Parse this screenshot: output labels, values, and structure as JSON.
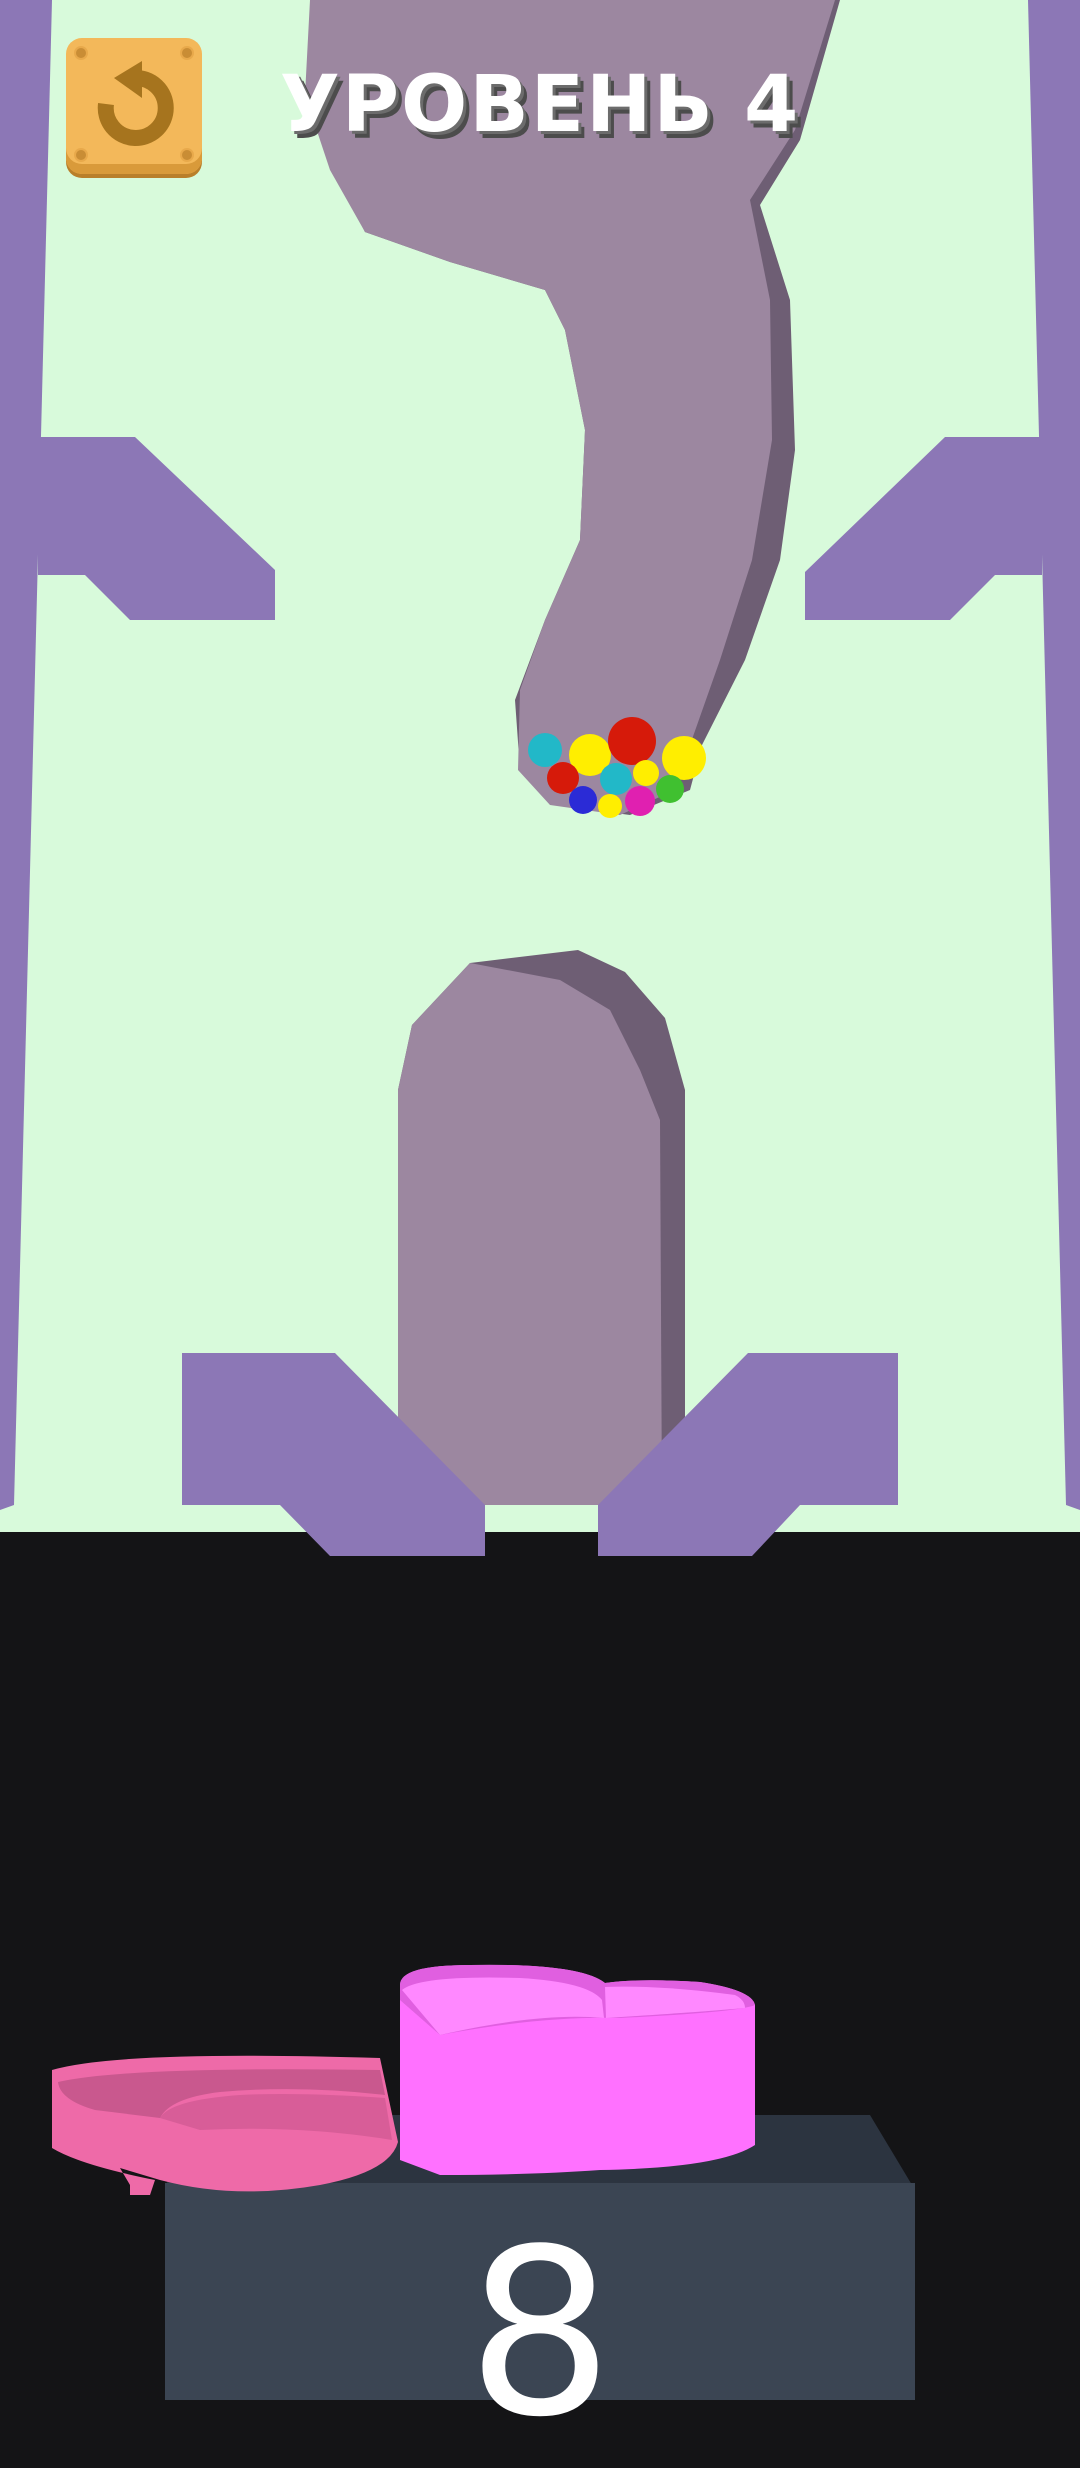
{
  "header": {
    "level_title": "УРОВЕНЬ 4",
    "restart_icon": "restart-arrow-icon"
  },
  "game": {
    "balls_in_dig": 11,
    "ball_colors": [
      "#22b8c8",
      "#ffee00",
      "#d61a0a",
      "#2b2bd6",
      "#e020b0",
      "#40c030"
    ],
    "cup_counter": "8",
    "colors": {
      "background": "#d8fadb",
      "walls": "#8c77b6",
      "dug_path": "#9c87a0",
      "cup": "#ff71ff",
      "pedestal": "#3b4553"
    }
  }
}
